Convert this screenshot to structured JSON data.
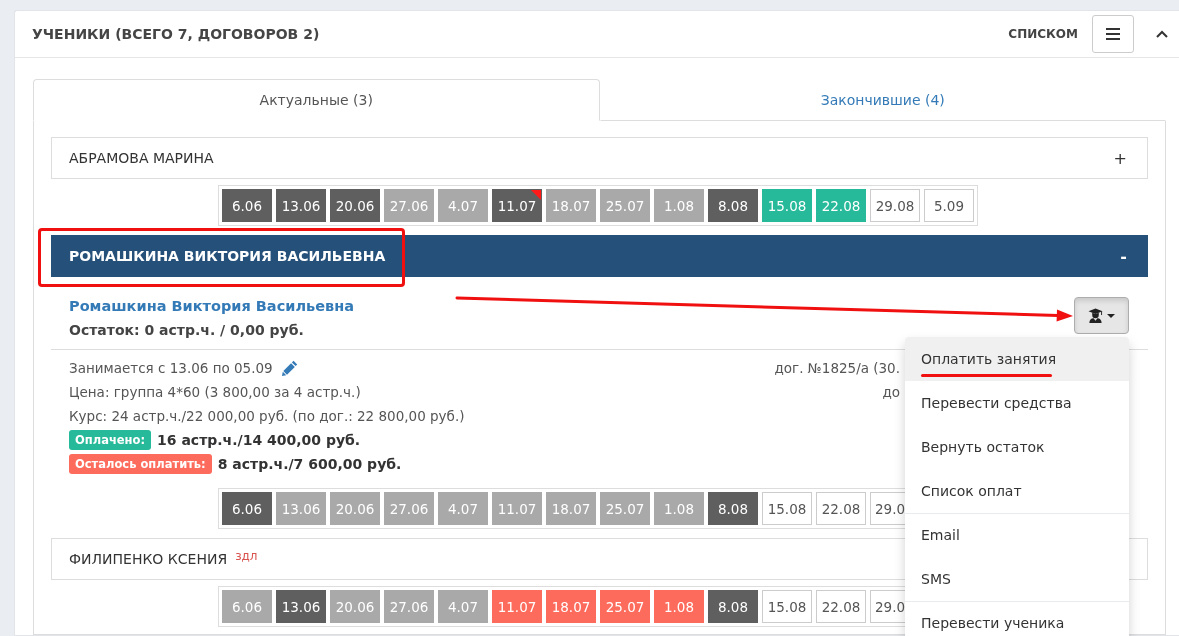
{
  "header": {
    "title": "УЧЕНИКИ (ВСЕГО 7, ДОГОВОРОВ 2)",
    "view_label": "СПИСКОМ"
  },
  "tabs": [
    {
      "label": "Актуальные (3)",
      "selected": true
    },
    {
      "label": "Закончившие (4)",
      "selected": false
    }
  ],
  "students": [
    {
      "name": "АБРАМОВА МАРИНА",
      "expanded": false,
      "toggle": "+",
      "dates_clipped": false,
      "dates": [
        {
          "label": "6.06",
          "color": "#5f5f5f",
          "flag": false
        },
        {
          "label": "13.06",
          "color": "#5f5f5f",
          "flag": false
        },
        {
          "label": "20.06",
          "color": "#5f5f5f",
          "flag": false
        },
        {
          "label": "27.06",
          "color": "#a9a9a9",
          "flag": false
        },
        {
          "label": "4.07",
          "color": "#a9a9a9",
          "flag": false
        },
        {
          "label": "11.07",
          "color": "#5f5f5f",
          "flag": true
        },
        {
          "label": "18.07",
          "color": "#a9a9a9",
          "flag": false
        },
        {
          "label": "25.07",
          "color": "#a9a9a9",
          "flag": false
        },
        {
          "label": "1.08",
          "color": "#a9a9a9",
          "flag": false
        },
        {
          "label": "8.08",
          "color": "#5f5f5f",
          "flag": false
        },
        {
          "label": "15.08",
          "color": "#26b99a",
          "flag": false
        },
        {
          "label": "22.08",
          "color": "#26b99a",
          "flag": false
        },
        {
          "label": "29.08",
          "color": "#ffffff",
          "flag": false
        },
        {
          "label": "5.09",
          "color": "#ffffff",
          "flag": false
        }
      ]
    },
    {
      "name": "РОМАШКИНА ВИКТОРИЯ ВАСИЛЬЕВНА",
      "expanded": true,
      "toggle": "-",
      "dates_clipped": true,
      "details": {
        "link": "Ромашкина Виктория Васильевна",
        "balance": "Остаток: 0 астр.ч. / 0,00 руб.",
        "actions_menu": {
          "open": true,
          "items": [
            {
              "label": "Оплатить занятия",
              "selected": true,
              "divider_before": false
            },
            {
              "label": "Перевести средства",
              "selected": false,
              "divider_before": false
            },
            {
              "label": "Вернуть остаток",
              "selected": false,
              "divider_before": false
            },
            {
              "label": "Список оплат",
              "selected": false,
              "divider_before": false
            },
            {
              "label": "Email",
              "selected": false,
              "divider_before": true
            },
            {
              "label": "SMS",
              "selected": false,
              "divider_before": false
            },
            {
              "label": "Перевести ученика",
              "selected": false,
              "divider_before": true
            }
          ]
        },
        "period": "Занимается с 13.06 по 05.09",
        "lines": [
          "Цена: группа 4*60 (3 800,00 за 4 астр.ч.)",
          "Курс: 24 астр.ч./22 000,00 руб. (по дог.: 22 800,00 руб.)"
        ],
        "payments": [
          {
            "badge": "Оплачено:",
            "color": "#26b99a",
            "amount": "16 астр.ч./14 400,00 руб."
          },
          {
            "badge": "Осталось оплатить:",
            "color": "#fd6b5c",
            "amount": "8 астр.ч./7 600,00 руб."
          }
        ],
        "contract": [
          "дог. №1825/а (30.",
          "до"
        ]
      },
      "dates": [
        {
          "label": "6.06",
          "color": "#5f5f5f",
          "flag": false
        },
        {
          "label": "13.06",
          "color": "#a9a9a9",
          "flag": false
        },
        {
          "label": "20.06",
          "color": "#a9a9a9",
          "flag": false
        },
        {
          "label": "27.06",
          "color": "#a9a9a9",
          "flag": false
        },
        {
          "label": "4.07",
          "color": "#a9a9a9",
          "flag": false
        },
        {
          "label": "11.07",
          "color": "#a9a9a9",
          "flag": false
        },
        {
          "label": "18.07",
          "color": "#a9a9a9",
          "flag": false
        },
        {
          "label": "25.07",
          "color": "#a9a9a9",
          "flag": false
        },
        {
          "label": "1.08",
          "color": "#a9a9a9",
          "flag": false
        },
        {
          "label": "8.08",
          "color": "#5f5f5f",
          "flag": false
        },
        {
          "label": "15.08",
          "color": "#ffffff",
          "flag": false
        },
        {
          "label": "22.08",
          "color": "#ffffff",
          "flag": false
        },
        {
          "label": "29.0",
          "color": "#ffffff",
          "flag": false
        }
      ]
    },
    {
      "name": "ФИЛИПЕНКО КСЕНИЯ",
      "tag": "здл",
      "expanded": false,
      "dates_clipped": true,
      "dates": [
        {
          "label": "6.06",
          "color": "#a9a9a9",
          "flag": false
        },
        {
          "label": "13.06",
          "color": "#5f5f5f",
          "flag": false
        },
        {
          "label": "20.06",
          "color": "#a9a9a9",
          "flag": false
        },
        {
          "label": "27.06",
          "color": "#a9a9a9",
          "flag": false
        },
        {
          "label": "4.07",
          "color": "#a9a9a9",
          "flag": false
        },
        {
          "label": "11.07",
          "color": "#fd6b5c",
          "flag": false
        },
        {
          "label": "18.07",
          "color": "#fd6b5c",
          "flag": false
        },
        {
          "label": "25.07",
          "color": "#fd6b5c",
          "flag": false
        },
        {
          "label": "1.08",
          "color": "#fd6b5c",
          "flag": false
        },
        {
          "label": "8.08",
          "color": "#5f5f5f",
          "flag": false
        },
        {
          "label": "15.08",
          "color": "#ffffff",
          "flag": false
        },
        {
          "label": "22.08",
          "color": "#ffffff",
          "flag": false
        },
        {
          "label": "29.0",
          "color": "#ffffff",
          "flag": false
        }
      ]
    }
  ]
}
